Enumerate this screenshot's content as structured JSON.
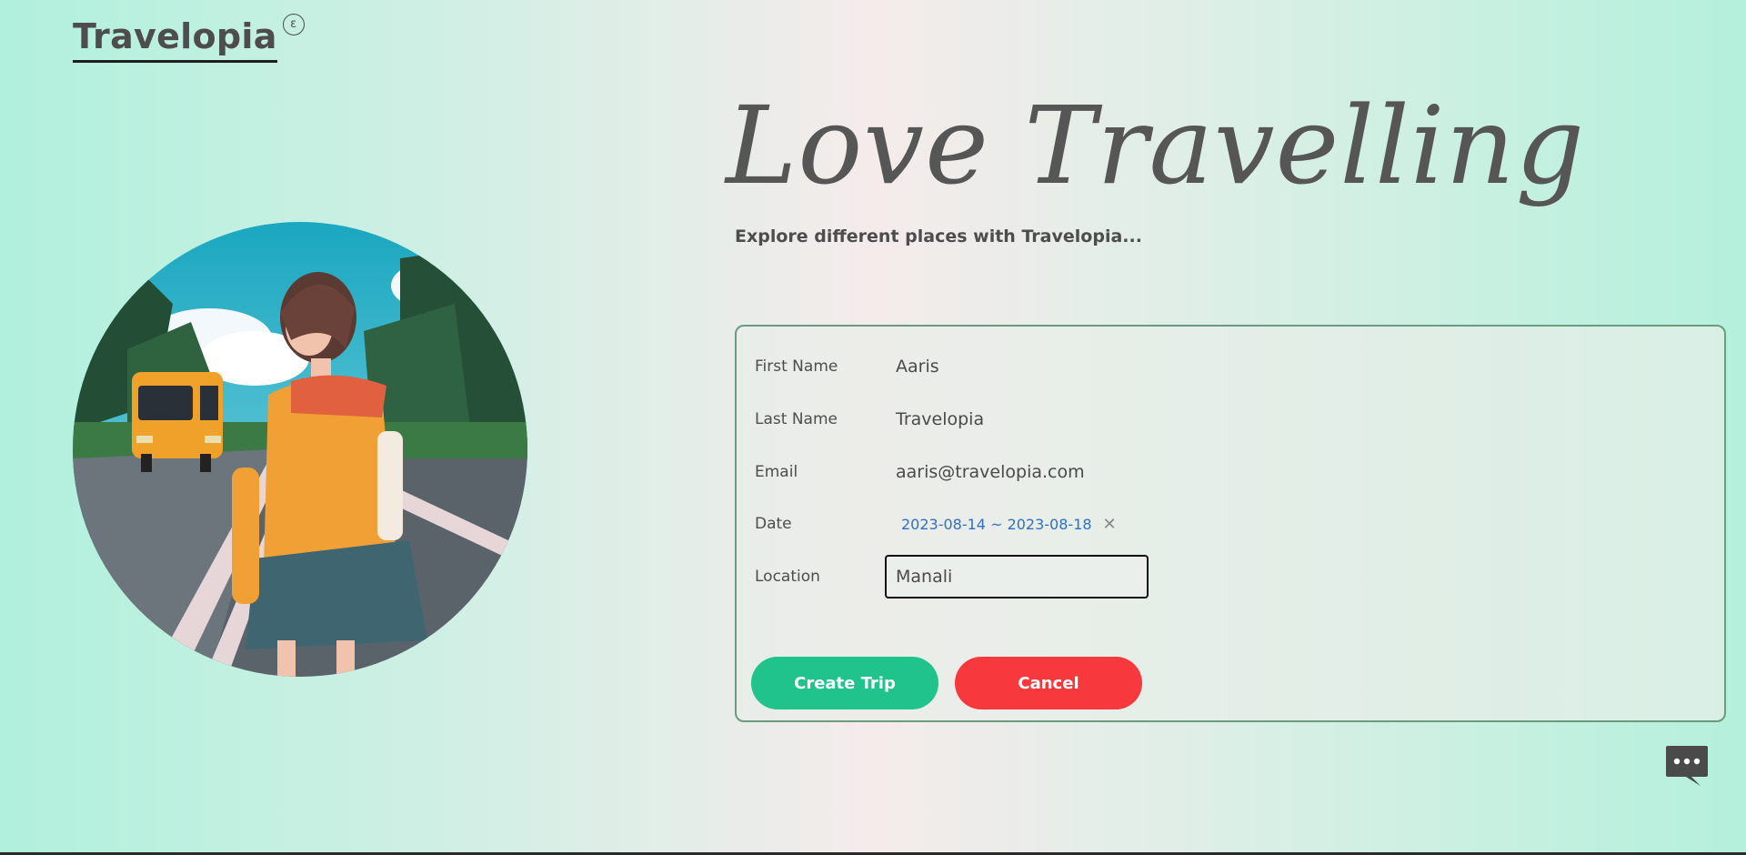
{
  "header": {
    "logo_text": "Travelopia",
    "logo_mark": "ε"
  },
  "hero": {
    "title": "Love Travelling",
    "subtitle": "Explore different places with Travelopia...",
    "image_icon": "traveler-illustration"
  },
  "form": {
    "first_name": {
      "label": "First Name",
      "value": "Aaris"
    },
    "last_name": {
      "label": "Last Name",
      "value": "Travelopia"
    },
    "email": {
      "label": "Email",
      "value": "aaris@travelopia.com"
    },
    "date": {
      "label": "Date",
      "value": "2023-08-14 ~ 2023-08-18",
      "clear_icon": "close-icon"
    },
    "location": {
      "label": "Location",
      "value": "Manali"
    }
  },
  "actions": {
    "create_label": "Create Trip",
    "cancel_label": "Cancel"
  },
  "chat": {
    "icon": "chat-bubble-icon"
  },
  "colors": {
    "create_button": "#1fc38b",
    "cancel_button": "#f7393d",
    "date_text": "#2f6fca",
    "panel_border": "#6a9a80"
  }
}
